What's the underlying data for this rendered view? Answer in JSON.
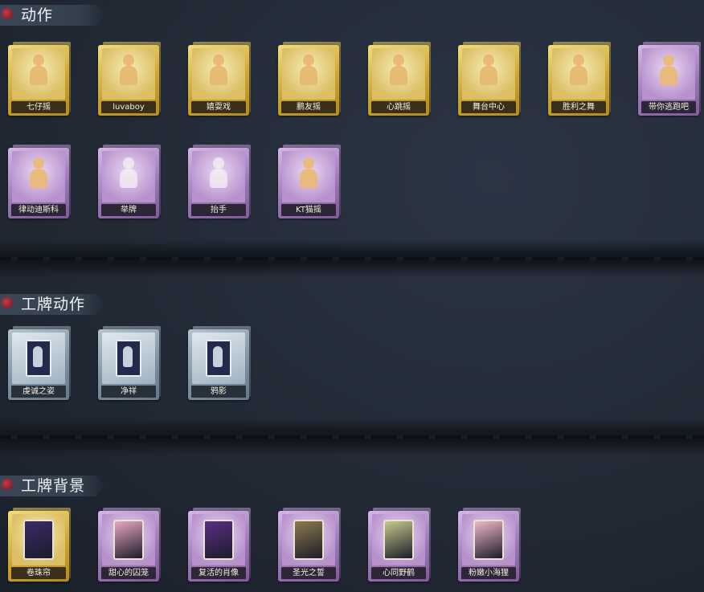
{
  "sections": [
    {
      "title": "动作",
      "items": [
        {
          "label": "七仔摇",
          "rarity": "gold",
          "icon": "dance-pose-icon"
        },
        {
          "label": "luvaboy",
          "rarity": "gold",
          "icon": "dance-pose-icon"
        },
        {
          "label": "嬉耍戏",
          "rarity": "gold",
          "icon": "dance-pose-icon"
        },
        {
          "label": "鹏友摇",
          "rarity": "gold",
          "icon": "dance-pose-icon"
        },
        {
          "label": "心跳摇",
          "rarity": "gold",
          "icon": "dance-pose-icon"
        },
        {
          "label": "舞台中心",
          "rarity": "gold",
          "icon": "dance-pose-icon"
        },
        {
          "label": "胜利之舞",
          "rarity": "gold",
          "icon": "dance-pose-icon"
        },
        {
          "label": "带你逃跑吧",
          "rarity": "purple",
          "icon": "dance-pose-icon"
        },
        {
          "label": "律动迪斯科",
          "rarity": "purple",
          "icon": "dance-pose-icon"
        },
        {
          "label": "举牌",
          "rarity": "purple",
          "icon": "sign-board-icon"
        },
        {
          "label": "抬手",
          "rarity": "purple",
          "icon": "ghost-hand-icon"
        },
        {
          "label": "KT猫摇",
          "rarity": "purple",
          "icon": "dance-pose-icon"
        }
      ]
    },
    {
      "title": "工牌动作",
      "items": [
        {
          "label": "虔诚之姿",
          "rarity": "steel",
          "icon": "badge-pose-icon"
        },
        {
          "label": "净祥",
          "rarity": "steel",
          "icon": "badge-pose-icon"
        },
        {
          "label": "鸦影",
          "rarity": "steel",
          "icon": "badge-pose-icon"
        }
      ]
    },
    {
      "title": "工牌背景",
      "items": [
        {
          "label": "卷珠帘",
          "rarity": "gold",
          "icon": "badge-background-icon",
          "thumb": "#3a2a6a"
        },
        {
          "label": "甜心的囚笼",
          "rarity": "purple",
          "icon": "badge-background-icon",
          "thumb": "#e8a7c2"
        },
        {
          "label": "复活的肖像",
          "rarity": "purple",
          "icon": "badge-background-icon",
          "thumb": "#5b2e86"
        },
        {
          "label": "圣光之誓",
          "rarity": "purple",
          "icon": "badge-background-icon",
          "thumb": "#8d7a4d"
        },
        {
          "label": "心同野鹤",
          "rarity": "purple",
          "icon": "badge-background-icon",
          "thumb": "#c7c98a"
        },
        {
          "label": "粉嫩小海狸",
          "rarity": "purple",
          "icon": "badge-background-icon",
          "thumb": "#f0b8c8"
        }
      ]
    }
  ]
}
